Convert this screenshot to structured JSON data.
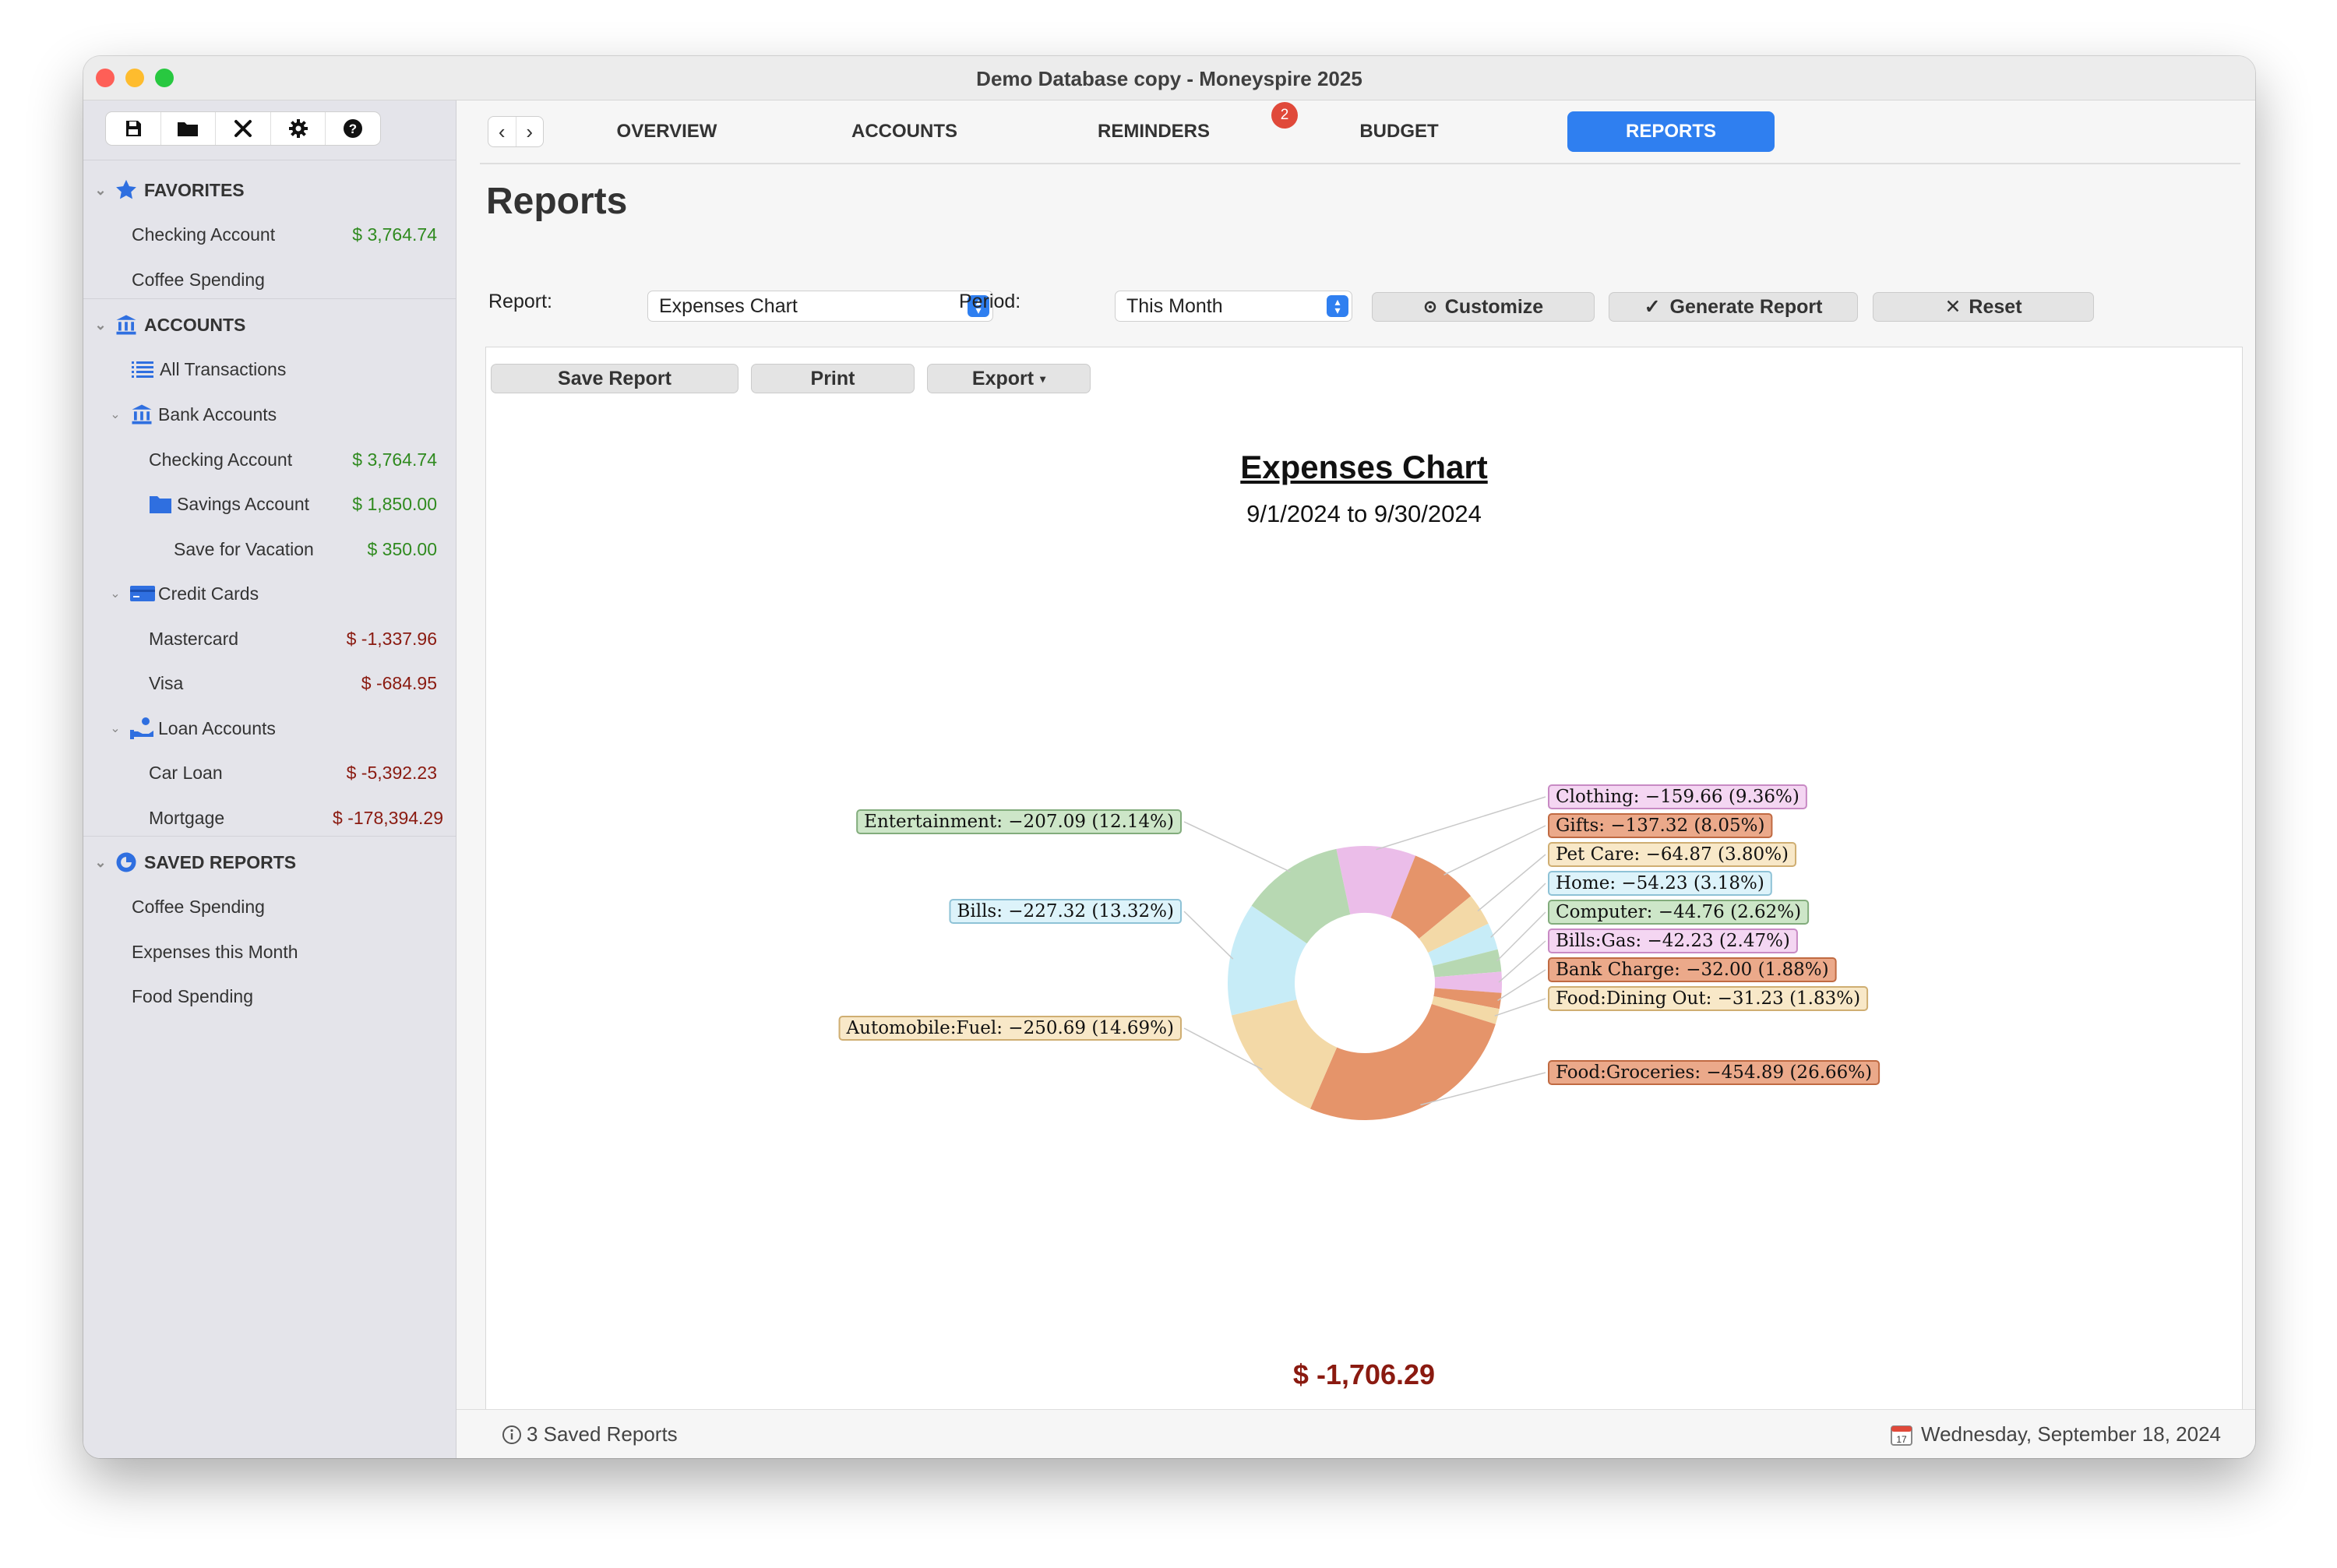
{
  "window": {
    "title": "Demo Database copy - Moneyspire 2025"
  },
  "sidebar": {
    "favorites": {
      "label": "FAVORITES",
      "items": [
        {
          "label": "Checking Account",
          "amount": "$ 3,764.74"
        },
        {
          "label": "Coffee Spending"
        }
      ]
    },
    "accounts": {
      "label": "ACCOUNTS",
      "all_transactions": "All Transactions",
      "bank": {
        "label": "Bank Accounts",
        "items": [
          {
            "label": "Checking Account",
            "amount": "$ 3,764.74"
          },
          {
            "label": "Savings Account",
            "amount": "$ 1,850.00"
          },
          {
            "label": "Save for Vacation",
            "amount": "$ 350.00"
          }
        ]
      },
      "credit": {
        "label": "Credit Cards",
        "items": [
          {
            "label": "Mastercard",
            "amount": "$ -1,337.96"
          },
          {
            "label": "Visa",
            "amount": "$ -684.95"
          }
        ]
      },
      "loan": {
        "label": "Loan Accounts",
        "items": [
          {
            "label": "Car Loan",
            "amount": "$ -5,392.23"
          },
          {
            "label": "Mortgage",
            "amount": "$ -178,394.29"
          }
        ]
      }
    },
    "saved_reports": {
      "label": "SAVED REPORTS",
      "items": [
        {
          "label": "Coffee Spending"
        },
        {
          "label": "Expenses this Month"
        },
        {
          "label": "Food Spending"
        }
      ]
    }
  },
  "tabs": {
    "overview": "OVERVIEW",
    "accounts": "ACCOUNTS",
    "reminders": "REMINDERS",
    "reminders_badge": "2",
    "budget": "BUDGET",
    "reports": "REPORTS"
  },
  "reports": {
    "title": "Reports",
    "report_label": "Report:",
    "report_value": "Expenses Chart",
    "period_label": "Period:",
    "period_value": "This Month",
    "customize": "Customize",
    "generate": "Generate Report",
    "reset": "Reset",
    "save_report": "Save Report",
    "print": "Print",
    "export": "Export",
    "total": "$ -1,706.29"
  },
  "colors": {
    "accent": "#2f7ff0",
    "positive": "#2f8a1f",
    "negative": "#8a1a10",
    "badge": "#e0493a"
  },
  "chart_data": {
    "type": "pie",
    "title": "Expenses Chart",
    "subtitle": "9/1/2024 to 9/30/2024",
    "slices": [
      {
        "name": "Clothing",
        "value": -159.66,
        "percent": 9.36,
        "label": "Clothing: −159.66 (9.36%)",
        "color": "#ebbde9"
      },
      {
        "name": "Gifts",
        "value": -137.32,
        "percent": 8.05,
        "label": "Gifts: −137.32 (8.05%)",
        "color": "#e5946a"
      },
      {
        "name": "Pet Care",
        "value": -64.87,
        "percent": 3.8,
        "label": "Pet Care: −64.87 (3.80%)",
        "color": "#f3d9a7"
      },
      {
        "name": "Home",
        "value": -54.23,
        "percent": 3.18,
        "label": "Home: −54.23 (3.18%)",
        "color": "#c7ecf7"
      },
      {
        "name": "Computer",
        "value": -44.76,
        "percent": 2.62,
        "label": "Computer: −44.76 (2.62%)",
        "color": "#b7d8b2"
      },
      {
        "name": "Bills:Gas",
        "value": -42.23,
        "percent": 2.47,
        "label": "Bills:Gas: −42.23 (2.47%)",
        "color": "#ebbde9"
      },
      {
        "name": "Bank Charge",
        "value": -32.0,
        "percent": 1.88,
        "label": "Bank Charge: −32.00 (1.88%)",
        "color": "#e5946a"
      },
      {
        "name": "Food:Dining Out",
        "value": -31.23,
        "percent": 1.83,
        "label": "Food:Dining Out: −31.23 (1.83%)",
        "color": "#f3d9a7"
      },
      {
        "name": "Food:Groceries",
        "value": -454.89,
        "percent": 26.66,
        "label": "Food:Groceries: −454.89 (26.66%)",
        "color": "#e5946a"
      },
      {
        "name": "Automobile:Fuel",
        "value": -250.69,
        "percent": 14.69,
        "label": "Automobile:Fuel: −250.69 (14.69%)",
        "color": "#f3d9a7"
      },
      {
        "name": "Bills",
        "value": -227.32,
        "percent": 13.32,
        "label": "Bills: −227.32 (13.32%)",
        "color": "#c7ecf7"
      },
      {
        "name": "Entertainment",
        "value": -207.09,
        "percent": 12.14,
        "label": "Entertainment: −207.09 (12.14%)",
        "color": "#b7d8b2"
      }
    ]
  },
  "status": {
    "saved_count": "3 Saved Reports",
    "date": "Wednesday, September 18, 2024"
  }
}
